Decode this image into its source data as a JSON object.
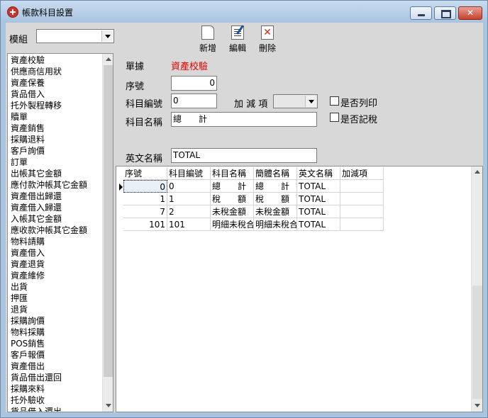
{
  "window": {
    "title": "帳款科目設置"
  },
  "toolbar": {
    "module_label": "模組",
    "module_value": "",
    "new_label": "新增",
    "edit_label": "編輯",
    "delete_label": "刪除"
  },
  "left_list": {
    "items": [
      "資產校驗",
      "供應商信用狀",
      "資產保養",
      "貨品借入",
      "托外製程轉移",
      "贖單",
      "資產銷售",
      "採購退料",
      "客戶詢價",
      "訂單",
      "出帳其它金額",
      "應付款沖帳其它金額",
      "資產借出歸還",
      "資產借入歸還",
      "入帳其它金額",
      "應收款沖帳其它金額",
      "物料請購",
      "資產借入",
      "資產退貨",
      "資產維修",
      "出貨",
      "押匯",
      "退貨",
      "採購詢價",
      "物料採購",
      "POS銷售",
      "客戶報價",
      "資產借出",
      "貨品借出還回",
      "採購來料",
      "托外驗收",
      "貨品借入還出"
    ]
  },
  "form": {
    "doc_label": "單據",
    "doc_value": "資產校驗",
    "seq_label": "序號",
    "seq_value": "0",
    "code_label": "科目編號",
    "code_value": "0",
    "addsub_label": "加 減 項",
    "addsub_value": "",
    "print_label": "是否列印",
    "tax_label": "是否記稅",
    "name_label": "科目名稱",
    "name_value": "總　　計",
    "en_label": "英文名稱",
    "en_value": "TOTAL"
  },
  "grid": {
    "headers": [
      "序號",
      "科目編號",
      "科目名稱",
      "簡體名稱",
      "英文名稱",
      "加減項"
    ],
    "rows": [
      [
        "0",
        "0",
        "總　　計",
        "總　　計",
        "TOTAL",
        ""
      ],
      [
        "1",
        "1",
        "稅　　額",
        "稅　　額",
        "TOTAL",
        ""
      ],
      [
        "7",
        "2",
        "未稅金額",
        "未稅金額",
        "TOTAL",
        ""
      ],
      [
        "101",
        "101",
        "明細未稅合",
        "明細未稅合",
        "TOTAL",
        ""
      ]
    ]
  },
  "colors": {
    "accent_red": "#e00000",
    "frame": "#aac4e0"
  }
}
